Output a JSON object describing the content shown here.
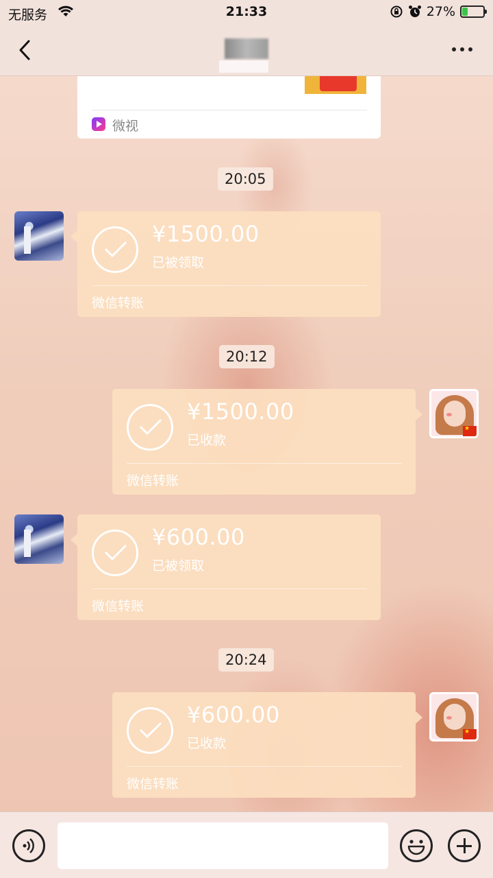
{
  "status_bar": {
    "carrier": "无服务",
    "time": "21:33",
    "battery_percent": "27%",
    "battery_level": 0.27,
    "icons": [
      "wifi-icon",
      "rotation-lock-icon",
      "alarm-icon",
      "battery-charging-icon"
    ]
  },
  "nav": {
    "back_icon": "chevron-left-icon",
    "more_icon": "more-dots-icon"
  },
  "link_card": {
    "app_name": "微视",
    "app_icon": "weishi-app-icon"
  },
  "messages": [
    {
      "type": "timestamp",
      "text": "20:05"
    },
    {
      "type": "transfer",
      "side": "left",
      "amount": "¥1500.00",
      "status": "已被领取",
      "label": "微信转账"
    },
    {
      "type": "timestamp",
      "text": "20:12"
    },
    {
      "type": "transfer",
      "side": "right",
      "amount": "¥1500.00",
      "status": "已收款",
      "label": "微信转账"
    },
    {
      "type": "transfer",
      "side": "left",
      "amount": "¥600.00",
      "status": "已被领取",
      "label": "微信转账"
    },
    {
      "type": "timestamp",
      "text": "20:24"
    },
    {
      "type": "transfer",
      "side": "right",
      "amount": "¥600.00",
      "status": "已收款",
      "label": "微信转账"
    }
  ],
  "input_bar": {
    "voice_icon": "voice-icon",
    "emoji_icon": "emoji-icon",
    "plus_icon": "plus-icon",
    "value": ""
  },
  "colors": {
    "transfer_bubble": "#fcdfbf",
    "status_bar_bg": "#f2e2dc",
    "battery_fill": "#3cc44a"
  }
}
